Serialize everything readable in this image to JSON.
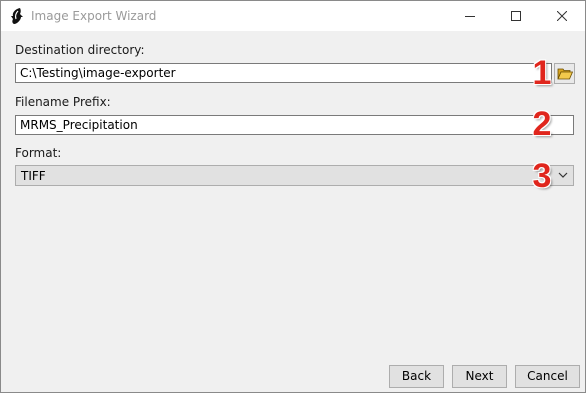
{
  "window": {
    "title": "Image Export Wizard",
    "icon": "app-logo-icon",
    "controls": {
      "minimize": "minimize-icon",
      "maximize": "maximize-icon",
      "close": "close-icon"
    }
  },
  "destination": {
    "label": "Destination directory:",
    "value": "C:\\Testing\\image-exporter",
    "browse_icon": "folder-open-icon"
  },
  "prefix": {
    "label": "Filename Prefix:",
    "value": "MRMS_Precipitation"
  },
  "format": {
    "label": "Format:",
    "selected": "TIFF",
    "arrow_icon": "chevron-down-icon"
  },
  "annotations": [
    "1",
    "2",
    "3"
  ],
  "annotation_color": "#e0261d",
  "buttons": {
    "back": "Back",
    "next": "Next",
    "cancel": "Cancel"
  }
}
